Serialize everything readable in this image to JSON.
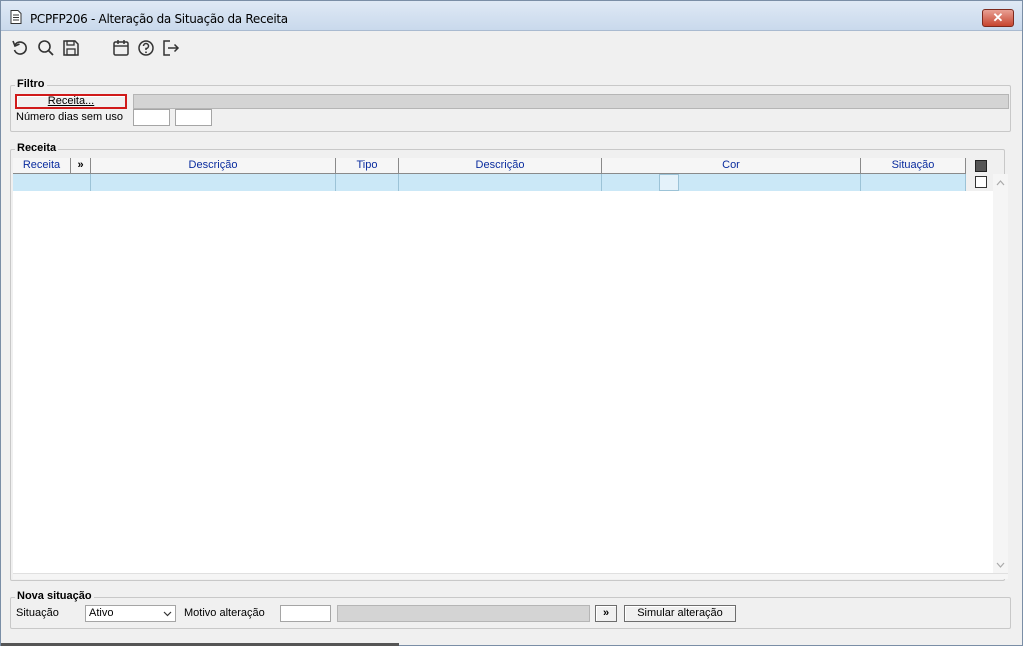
{
  "window": {
    "title": "PCPFP206 - Alteração da Situação da Receita",
    "close_label": "✕"
  },
  "toolbar": {
    "icons": [
      "undo-icon",
      "search-icon",
      "save-icon",
      "calendar-icon",
      "help-icon",
      "exit-icon"
    ]
  },
  "filtro": {
    "legend": "Filtro",
    "receita_button": "Receita...",
    "dias_label": "Número dias sem uso"
  },
  "receita_grid": {
    "legend": "Receita",
    "columns": [
      "Receita",
      "»",
      "Descrição",
      "Tipo",
      "Descrição",
      "Cor",
      "Situação"
    ]
  },
  "nova_situacao": {
    "legend": "Nova situação",
    "situacao_label": "Situação",
    "situacao_value": "Ativo",
    "motivo_label": "Motivo alteração",
    "more_button": "»",
    "simular_button": "Simular alteração"
  },
  "colors": {
    "selected_row": "#cbe8f7",
    "header_text": "#0a2c9e",
    "highlight_border": "#d01a1a"
  }
}
